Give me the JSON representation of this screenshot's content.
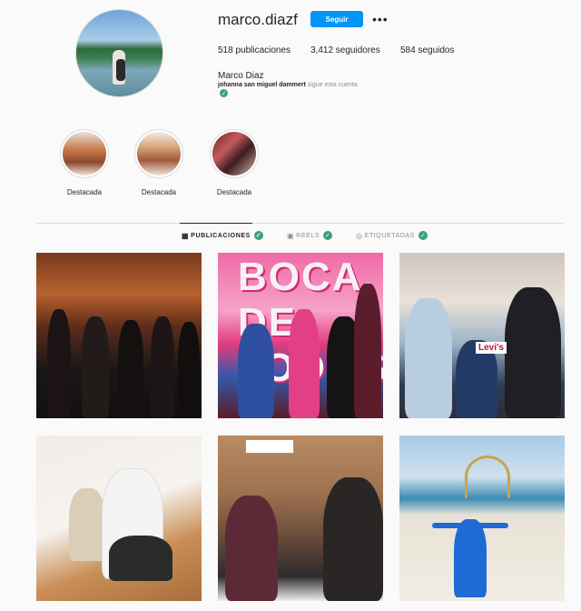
{
  "profile": {
    "username": "marco.diazf",
    "follow_label": "Seguir",
    "more_icon": "more-horizontal-icon",
    "posts_count": "518 publicaciones",
    "followers_count": "3,412 seguidores",
    "following_count": "584 seguidos",
    "full_name": "Marco Diaz",
    "followed_by_name": "johanna san miguel dammert",
    "followed_by_suffix": "sigue esta cuenta"
  },
  "highlights": [
    {
      "label": "Destacada"
    },
    {
      "label": "Destacada"
    },
    {
      "label": "Destacada"
    }
  ],
  "tabs": [
    {
      "label": "PUBLICACIONES",
      "icon": "grid-icon",
      "active": true
    },
    {
      "label": "REELS",
      "icon": "reels-icon",
      "active": false
    },
    {
      "label": "ETIQUETADAS",
      "icon": "tagged-icon",
      "active": false
    }
  ],
  "posts": [
    {
      "overlay": ""
    },
    {
      "overlay": "BOCA DE TODOS"
    },
    {
      "overlay": "Levi's"
    },
    {
      "overlay": ""
    },
    {
      "overlay": ""
    },
    {
      "overlay": ""
    }
  ],
  "colors": {
    "accent": "#0095f6",
    "verified": "#3aa17e",
    "background": "#fafafa"
  }
}
